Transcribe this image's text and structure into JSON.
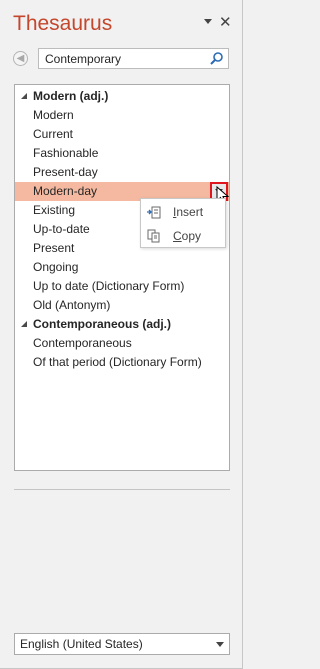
{
  "title": "Thesaurus",
  "title_controls": {
    "options_icon": "chevron-down-icon",
    "close_icon": "close-icon"
  },
  "search": {
    "value": "Contemporary",
    "icon": "search-icon"
  },
  "results": {
    "groups": [
      {
        "heading": "Modern (adj.)",
        "items": [
          "Modern",
          "Current",
          "Fashionable",
          "Present-day",
          "Modern-day",
          "Existing",
          "Up-to-date",
          "Present",
          "Ongoing",
          "Up to date (Dictionary Form)",
          "Old (Antonym)"
        ]
      },
      {
        "heading": "Contemporaneous (adj.)",
        "items": [
          "Contemporaneous",
          "Of that period (Dictionary Form)"
        ]
      }
    ],
    "selected_item": "Modern-day"
  },
  "context_menu": {
    "items": [
      {
        "underlined": "I",
        "rest": "nsert",
        "icon": "insert-icon"
      },
      {
        "underlined": "C",
        "rest": "opy",
        "icon": "copy-icon"
      }
    ]
  },
  "language": {
    "selected": "English (United States)"
  },
  "colors": {
    "title": "#c4472c",
    "selection": "#f4b9a0",
    "dropdown_highlight": "#e0161f"
  }
}
